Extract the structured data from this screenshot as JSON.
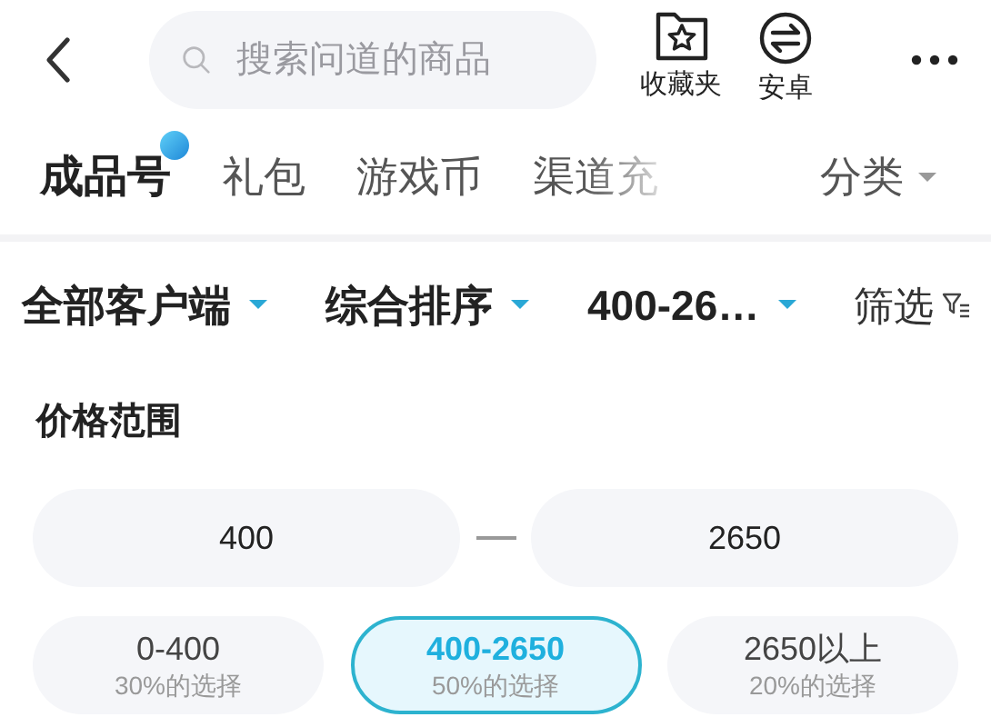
{
  "header": {
    "search": {
      "placeholder": "搜索问道的商品"
    },
    "actions": [
      {
        "kind": "favorites",
        "label": "收藏夹"
      },
      {
        "kind": "platform",
        "label": "安卓"
      }
    ]
  },
  "tabs": [
    {
      "label": "成品号",
      "selected": true,
      "badge": true
    },
    {
      "label": "礼包",
      "selected": false,
      "badge": false
    },
    {
      "label": "游戏币",
      "selected": false,
      "badge": false
    },
    {
      "label": "渠道充",
      "selected": false,
      "badge": false
    },
    {
      "label": "分类",
      "selected": false,
      "badge": false,
      "kind": "dropdown"
    }
  ],
  "filters": [
    {
      "label": "全部客户端",
      "kind": "dropdown"
    },
    {
      "label": "综合排序",
      "kind": "dropdown"
    },
    {
      "label": "400-26…",
      "kind": "dropdown"
    },
    {
      "label": "筛选",
      "kind": "filter"
    }
  ],
  "price_range": {
    "title": "价格范围",
    "min": "400",
    "max": "2650",
    "presets": [
      {
        "range": "0-400",
        "share": "30%的选择",
        "selected": false
      },
      {
        "range": "400-2650",
        "share": "50%的选择",
        "selected": true
      },
      {
        "range": "2650以上",
        "share": "20%的选择",
        "selected": false
      }
    ]
  }
}
